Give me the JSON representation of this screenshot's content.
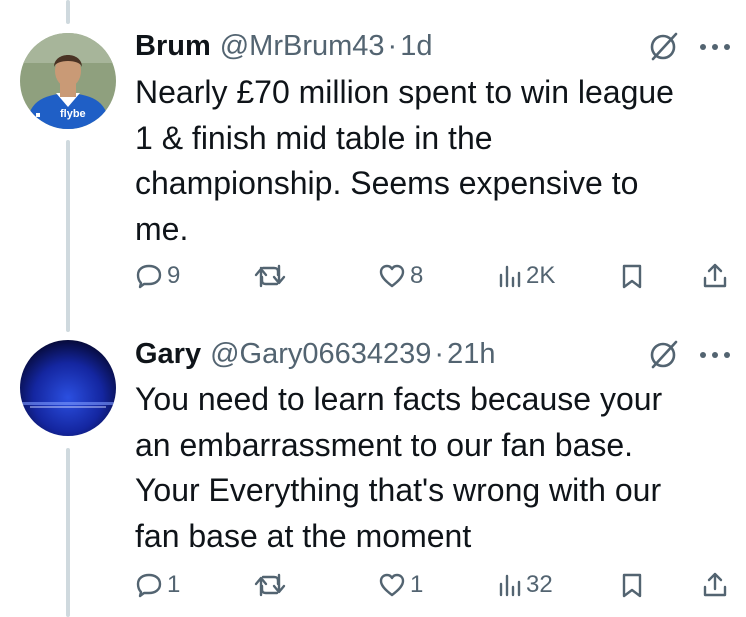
{
  "tweets": [
    {
      "display_name": "Brum",
      "handle": "@MrBrum43",
      "separator": "·",
      "time": "1d",
      "text": "Nearly £70 million spent to win league\n1 & finish mid table in the\nchampionship. Seems expensive to\nme.",
      "avatar_badge": "flybe",
      "stats": {
        "replies": "9",
        "likes": "8",
        "views": "2K"
      }
    },
    {
      "display_name": "Gary",
      "handle": "@Gary06634239",
      "separator": "·",
      "time": "21h",
      "text": "You need to learn facts because your\nan embarrassment to our fan base.\nYour Everything that's wrong with our\nfan base at the moment",
      "stats": {
        "replies": "1",
        "likes": "1",
        "views": "32"
      }
    }
  ],
  "icons": {
    "reply": "reply-icon",
    "retweet": "retweet-icon",
    "like": "like-icon",
    "views": "views-icon",
    "bookmark": "bookmark-icon",
    "share": "share-icon",
    "grok": "grok-icon",
    "more": "more-icon"
  },
  "colors": {
    "text": "#0f1419",
    "secondary": "#536471",
    "thread_line": "#cfd9de"
  }
}
